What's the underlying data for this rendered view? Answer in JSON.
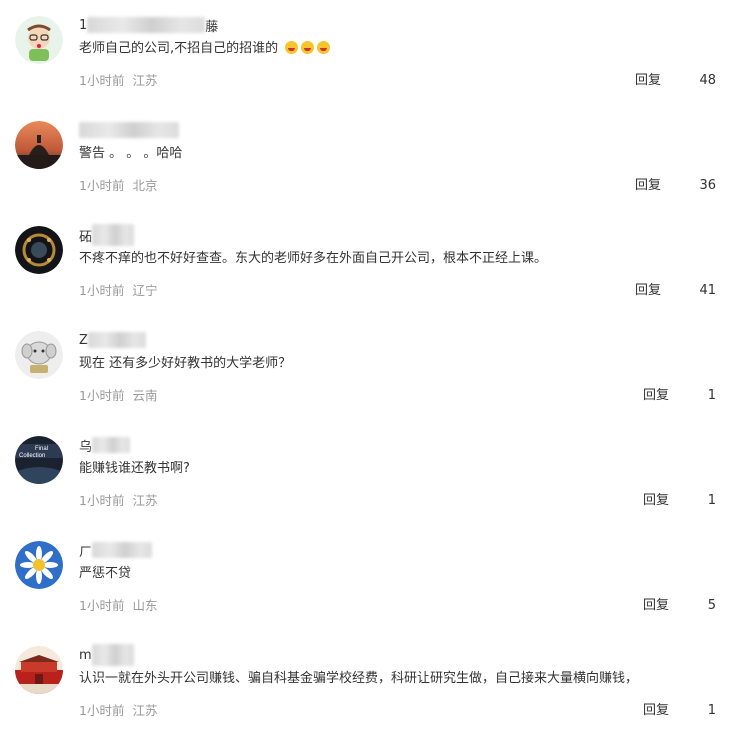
{
  "comments": [
    {
      "name_visible": "1",
      "name_tail": "藤",
      "text": "老师自己的公司,不招自己的招谁的",
      "emoji_names": [
        "laughing-tears-icon",
        "laughing-tears-icon",
        "laughing-tears-icon"
      ],
      "time": "1小时前",
      "location": "江苏",
      "reply_label": "回复",
      "likes": "48"
    },
    {
      "name_visible": "",
      "name_tail": "",
      "text": "警告 。 。 。哈哈",
      "time": "1小时前",
      "location": "北京",
      "reply_label": "回复",
      "likes": "36"
    },
    {
      "name_visible": "砳",
      "name_tail": "",
      "text": "不疼不痒的也不好好查查。东大的老师好多在外面自己开公司，根本不正经上课。",
      "time": "1小时前",
      "location": "辽宁",
      "reply_label": "回复",
      "likes": "41"
    },
    {
      "name_visible": "Z",
      "name_tail": "",
      "text": "现在 还有多少好好教书的大学老师？",
      "time": "1小时前",
      "location": "云南",
      "reply_label": "回复",
      "likes": "1"
    },
    {
      "name_visible": "乌",
      "name_tail": "",
      "text": "能赚钱谁还教书啊?",
      "time": "1小时前",
      "location": "江苏",
      "reply_label": "回复",
      "likes": "1"
    },
    {
      "name_visible": "ㄏ",
      "name_tail": "",
      "text": "严惩不贷",
      "time": "1小时前",
      "location": "山东",
      "reply_label": "回复",
      "likes": "5"
    },
    {
      "name_visible": "m",
      "name_tail": "",
      "text": "认识一就在外头开公司赚钱、骗自科基金骗学校经费，科研让研究生做，自己接来大量横向赚钱，",
      "time": "1小时前",
      "location": "江苏",
      "reply_label": "回复",
      "likes": "1"
    }
  ]
}
